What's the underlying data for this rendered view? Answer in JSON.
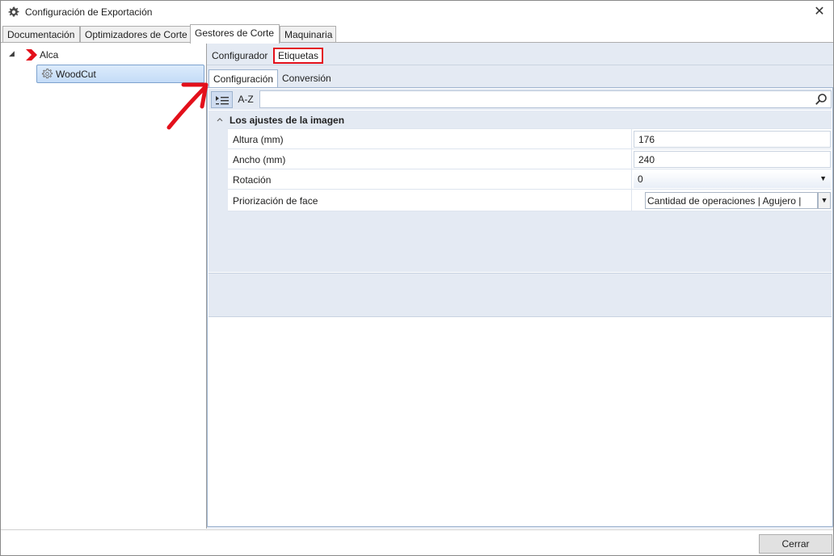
{
  "window": {
    "title": "Configuración de Exportación",
    "close_symbol": "✕"
  },
  "main_tabs": [
    {
      "label": "Documentación"
    },
    {
      "label": "Optimizadores de Corte"
    },
    {
      "label": "Gestores de Corte",
      "active": true
    },
    {
      "label": "Maquinaria"
    }
  ],
  "tree": {
    "expander_glyph": "◢",
    "root_label": "Alca",
    "child_label": "WoodCut"
  },
  "sub_tabs": {
    "configurador": "Configurador",
    "etiquetas": "Etiquetas"
  },
  "inner_tabs": {
    "configuracion": "Configuración",
    "conversion": "Conversión"
  },
  "property_grid": {
    "toolbar": {
      "sort_az_label": "A-Z",
      "search_placeholder": ""
    },
    "category": {
      "title": "Los ajustes de la imagen",
      "chevron": "^"
    },
    "rows": [
      {
        "name": "Altura (mm)",
        "value": "176"
      },
      {
        "name": "Ancho (mm)",
        "value": "240"
      },
      {
        "name": "Rotación",
        "value": "0"
      },
      {
        "name": "Priorización de face",
        "value": "Cantidad de operaciones | Agujero | "
      }
    ]
  },
  "footer": {
    "close_label": "Cerrar"
  },
  "colors": {
    "annotation_red": "#e3101b",
    "selection_blue": "#c4dcf7",
    "panel_bg": "#e4eaf3"
  },
  "icons": {
    "app": "gear-icon",
    "tree_root": "red-chevron-icon",
    "tree_child": "gear-icon",
    "categorized": "categorized-list-icon",
    "search": "search-icon",
    "dropdown": "chevron-down-icon"
  }
}
